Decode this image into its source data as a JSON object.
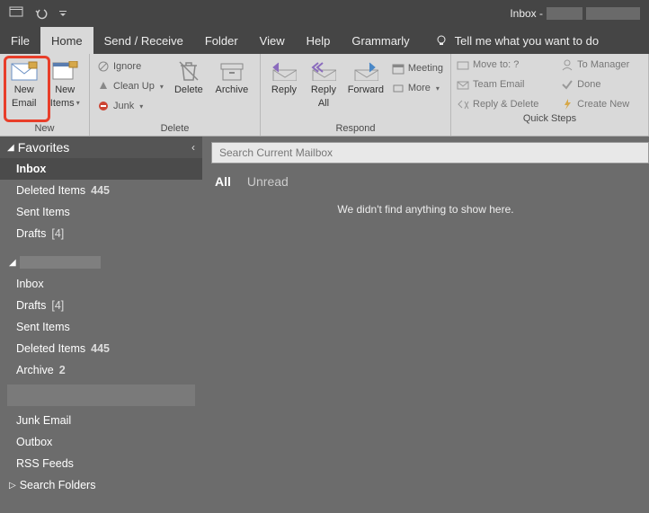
{
  "titlebar": {
    "title_prefix": "Inbox -"
  },
  "tabs": {
    "file": "File",
    "home": "Home",
    "send_receive": "Send / Receive",
    "folder": "Folder",
    "view": "View",
    "help": "Help",
    "grammarly": "Grammarly",
    "tell_me": "Tell me what you want to do"
  },
  "ribbon": {
    "new_group": "New",
    "new_email_l1": "New",
    "new_email_l2": "Email",
    "new_items_l1": "New",
    "new_items_l2": "Items",
    "delete_group": "Delete",
    "ignore": "Ignore",
    "clean_up": "Clean Up",
    "junk": "Junk",
    "delete": "Delete",
    "archive": "Archive",
    "respond_group": "Respond",
    "reply": "Reply",
    "reply_all_l1": "Reply",
    "reply_all_l2": "All",
    "forward": "Forward",
    "meeting": "Meeting",
    "more": "More",
    "quick_steps_group": "Quick Steps",
    "move_to": "Move to: ?",
    "team_email": "Team Email",
    "reply_delete": "Reply & Delete",
    "to_manager": "To Manager",
    "done": "Done",
    "create_new": "Create New"
  },
  "nav": {
    "favorites": "Favorites",
    "inbox": "Inbox",
    "deleted_items_label": "Deleted Items",
    "deleted_items_count": "445",
    "sent_items": "Sent Items",
    "drafts_label": "Drafts",
    "drafts_count": "[4]",
    "inbox2": "Inbox",
    "drafts2_label": "Drafts",
    "drafts2_count": "[4]",
    "sent_items2": "Sent Items",
    "deleted_items2_label": "Deleted Items",
    "deleted_items2_count": "445",
    "archive_label": "Archive",
    "archive_count": "2",
    "junk": "Junk Email",
    "outbox": "Outbox",
    "rss": "RSS Feeds",
    "search_folders": "Search Folders"
  },
  "content": {
    "search_placeholder": "Search Current Mailbox",
    "filter_all": "All",
    "filter_unread": "Unread",
    "empty": "We didn't find anything to show here."
  }
}
